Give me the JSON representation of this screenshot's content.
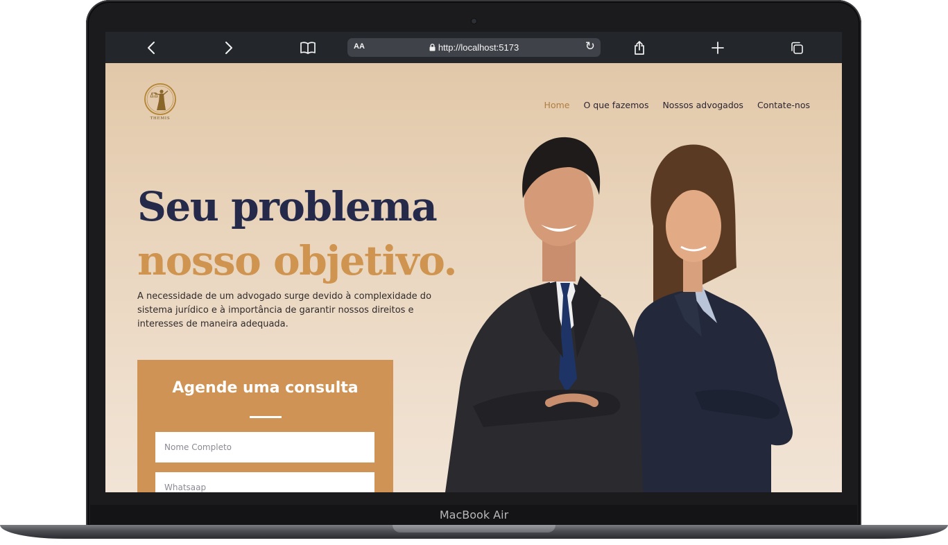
{
  "browser": {
    "url": "http://localhost:5173",
    "text_size_label": "AA",
    "icons": [
      "back-icon",
      "forward-icon",
      "book-icon",
      "lock-icon",
      "reload-icon",
      "share-icon",
      "new-tab-icon",
      "tabs-icon"
    ]
  },
  "device": {
    "label": "MacBook Air"
  },
  "site": {
    "logo_text": "THEMIS",
    "nav": [
      {
        "label": "Home",
        "active": true
      },
      {
        "label": "O que fazemos",
        "active": false
      },
      {
        "label": "Nossos advogados",
        "active": false
      },
      {
        "label": "Contate-nos",
        "active": false
      }
    ]
  },
  "hero": {
    "title_line1": "Seu problema",
    "title_line2": "nosso objetivo.",
    "description": "A necessidade de um advogado surge devido à complexidade do sistema jurídico e à importância de garantir nossos direitos e interesses de maneira adequada."
  },
  "form": {
    "title": "Agende uma consulta",
    "fields": [
      {
        "placeholder": "Nome Completo"
      },
      {
        "placeholder": "Whatsaap"
      }
    ]
  },
  "colors": {
    "accent": "#cf944f",
    "navy": "#262a4a",
    "nav_active": "#b07d40",
    "form_bg": "#cf9455"
  }
}
